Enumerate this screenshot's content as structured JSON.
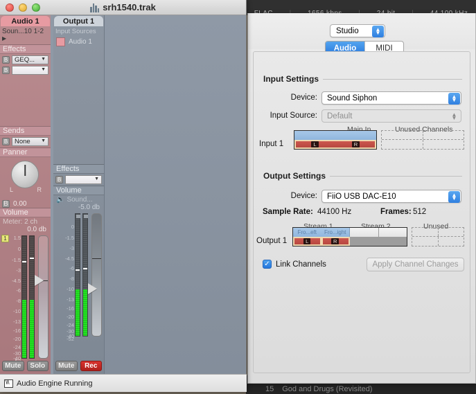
{
  "background_app": {
    "topbar": {
      "format": "FLAC",
      "bitrate": "1656 kbps",
      "depth": "24 bit",
      "rate": "44.100 kHz"
    },
    "bottombar": {
      "track_number": "15",
      "track_title": "God and Drugs (Revisited)"
    }
  },
  "daw_window": {
    "title": "srh1540.trak",
    "traffic_lights": {
      "close": "close-button",
      "minimize": "minimize-button",
      "zoom": "zoom-button"
    },
    "status": {
      "icon": "waveform-icon",
      "text": "Audio Engine Running"
    },
    "strips": [
      {
        "header": "Audio 1",
        "source": "Soun...10 1-2",
        "disclosure": "▶",
        "effects_label": "Effects",
        "effects": [
          {
            "bypass": "B",
            "value": "GEQ..."
          },
          {
            "bypass": "B",
            "value": ""
          }
        ],
        "sends_label": "Sends",
        "sends": {
          "bypass": "B",
          "value": "None"
        },
        "panner_label": "Panner",
        "panner": {
          "left": "L",
          "right": "R",
          "bypass": "B",
          "value": "0.00"
        },
        "volume_label": "Volume",
        "meter_label": "Meter: 2 ch",
        "db_value": "0.0 db",
        "channel_number": "1",
        "buttons": [
          "Mute",
          "Solo"
        ]
      },
      {
        "header": "Output 1",
        "input_sources_label": "Input Sources",
        "input_source": "Audio 1",
        "effects_label": "Effects",
        "effects": [
          {
            "bypass": "B",
            "value": ""
          }
        ],
        "volume_label": "Volume",
        "meter_label": "Sound...",
        "meter_icon": "speaker-icon",
        "db_value": "-5.0 db",
        "buttons": [
          "Mute",
          "Rec"
        ]
      }
    ],
    "meter_scale": [
      "1.5",
      "0",
      "-1.5",
      "-3",
      "-4.5",
      "-6",
      "-8",
      "-10",
      "-13",
      "-16",
      "-20",
      "-24",
      "-30",
      "-40",
      "-52",
      "-∞"
    ]
  },
  "prefs_window": {
    "studio_popup": {
      "value": "Studio",
      "icon": "chevron-updown-icon"
    },
    "tabs": [
      {
        "label": "Audio",
        "selected": true
      },
      {
        "label": "MIDI",
        "selected": false
      }
    ],
    "input_settings": {
      "title": "Input Settings",
      "device_label": "Device:",
      "device_value": "Sound Siphon",
      "input_source_label": "Input Source:",
      "input_source_value": "Default",
      "columns": [
        "Main In",
        "Unused Channels"
      ],
      "row_label": "Input 1",
      "main_in_channels": [
        "L",
        "R"
      ]
    },
    "output_settings": {
      "title": "Output Settings",
      "device_label": "Device:",
      "device_value": "FiiO USB DAC-E10",
      "sample_rate_label": "Sample Rate:",
      "sample_rate_value": "44100 Hz",
      "frames_label": "Frames:",
      "frames_value": "512",
      "columns": [
        "Stream 1",
        "Stream 2",
        "Unused"
      ],
      "row_label": "Output 1",
      "stream1_names": [
        "Fro...eft",
        "Fro...ight"
      ],
      "stream1_channels": [
        "L",
        "R"
      ],
      "link_channels_label": "Link Channels",
      "link_channels_checked": true,
      "apply_button": "Apply Channel Changes",
      "apply_enabled": false
    }
  }
}
